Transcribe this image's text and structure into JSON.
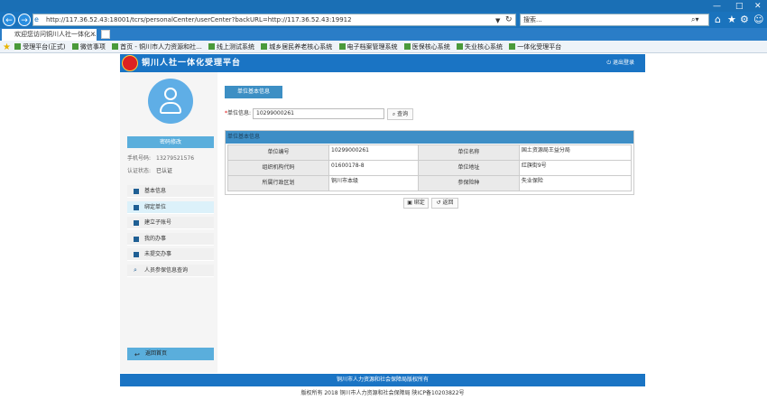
{
  "browser": {
    "window_controls": {
      "minimize": "—",
      "maximize": "□",
      "close": "✕"
    },
    "url": "http://117.36.52.43:18001/tcrs/personalCenter/userCenter?backURL=http://117.36.52.43:19912",
    "search_placeholder": "搜索...",
    "tab_title": "欢迎您访问铜川人社一体化...",
    "favorites": [
      "受理平台(正式)",
      "微信事项",
      "首页 - 铜川市人力资源和社...",
      "线上测试系统",
      "城乡居民养老核心系统",
      "电子档案管理系统",
      "医保核心系统",
      "失业核心系统",
      "一体化受理平台"
    ]
  },
  "header": {
    "title": "铜川人社一体化受理平台",
    "logout": "退出登录"
  },
  "sidebar": {
    "pwd_btn": "密码修改",
    "phone_label": "手机号码:",
    "phone_value": "13279521576",
    "auth_label": "认证状态:",
    "auth_value": "已认证",
    "menu": [
      "基本信息",
      "绑定单位",
      "建立子账号",
      "我的办事",
      "未提交办事",
      "人员参保信息查询"
    ],
    "back_home": "返回首页"
  },
  "main": {
    "section_btn": "单位基本信息",
    "query_label": "单位信息:",
    "query_value": "10299000261",
    "query_btn": "查询",
    "panel_title": "单位基本信息",
    "rows": [
      [
        "单位编号",
        "10299000261",
        "单位名称",
        "国土资源局王益分局"
      ],
      [
        "组织机构代码",
        "01600178-8",
        "单位地址",
        "红旗街9号"
      ],
      [
        "所属行政区划",
        "铜川市本级",
        "参保险种",
        "失业保险"
      ]
    ],
    "bind_btn": "绑定",
    "back_btn": "返回"
  },
  "footer": {
    "line1": "铜川市人力资源和社会保障局版权所有",
    "line2": "版权所有 2018 铜川市人力资源和社会保障局 陕ICP备10203822号"
  }
}
